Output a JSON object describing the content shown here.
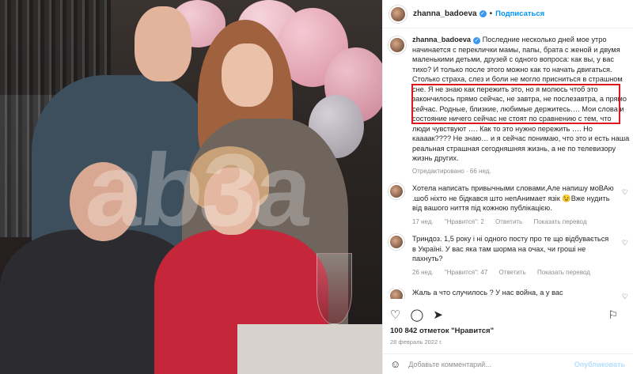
{
  "photo": {
    "watermark": "ab3a"
  },
  "header": {
    "username": "zhanna_badoeva",
    "separator": "•",
    "follow_label": "Подписаться"
  },
  "caption": {
    "username": "zhanna_badoeva",
    "text": " Последние несколько дней мое утро начинается с переклички мамы, папы, брата с женой и двумя маленькими детьми, друзей с одного вопроса: как вы, у вас тихо? И только после этого можно как то начать двигаться. Столько страха, слез и боли не могло присниться в страшном сне. Я не знаю как пережить это, но я молюсь чтоб это закончилось прямо сейчас, не завтра, не послезавтра, а прямо сейчас. Родные, близкие, любимые держитесь…. Мои слова и состояние ничего сейчас не стоят по сравнению с тем, что люди чувствуют …. Как то это нужно пережить …. Но каааак???? Не знаю… и я сейчас понимаю, что это и есть наша реальная страшная сегодняшняя жизнь, а не по телевизору жизнь других.",
    "edited": "Отредактировано · 66 нед."
  },
  "comments": [
    {
      "text": "Хотела написать привычными словами,Але напишу моВАю .шоб ніхто не бідкався што непАнимает язік 😉Вже нудить від вашого ниття під кожною публікацією.",
      "age": "17 нед.",
      "likes": "\"Нравится\": 2",
      "reply": "Ответить",
      "translate": "Показать перевод"
    },
    {
      "text": " Триндоз. 1,5 року і ні одного посту про те що відбувається в Україні. У вас яка там шорма на очах, чи гроші не пахнуть?",
      "age": "26 нед.",
      "likes": "\"Нравится\": 47",
      "reply": "Ответить",
      "translate": "Показать перевод"
    },
    {
      "text": "Жаль а что случилось ? У нас война, а у вас"
    }
  ],
  "actions": {
    "like_icon": "heart-icon",
    "comment_icon": "comment-icon",
    "share_icon": "share-icon",
    "save_icon": "bookmark-icon"
  },
  "likes": "100 842 отметок \"Нравится\"",
  "date": "28 февраль 2022 г.",
  "add_comment": {
    "placeholder": "Добавьте комментарий...",
    "publish_label": "Опубликовать"
  }
}
